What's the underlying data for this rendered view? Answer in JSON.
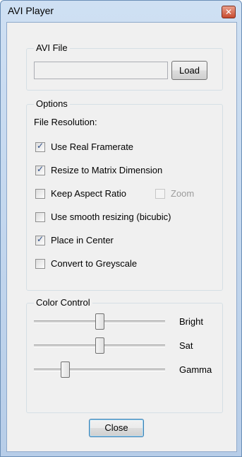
{
  "window": {
    "title": "AVI Player",
    "close_glyph": "✕"
  },
  "avi_file": {
    "legend": "AVI File",
    "path_value": "",
    "load_label": "Load"
  },
  "options": {
    "legend": "Options",
    "file_resolution_label": "File Resolution:",
    "use_real_framerate": {
      "label": "Use Real Framerate",
      "checked": true
    },
    "resize_to_matrix": {
      "label": "Resize to Matrix Dimension",
      "checked": true
    },
    "keep_aspect_ratio": {
      "label": "Keep Aspect Ratio",
      "checked": false
    },
    "zoom": {
      "label": "Zoom",
      "checked": false,
      "enabled": false
    },
    "smooth_resizing": {
      "label": "Use smooth resizing (bicubic)",
      "checked": false
    },
    "place_in_center": {
      "label": "Place in Center",
      "checked": true
    },
    "convert_greyscale": {
      "label": "Convert to Greyscale",
      "checked": false
    }
  },
  "color_control": {
    "legend": "Color Control",
    "bright": {
      "label": "Bright",
      "level": 0.5
    },
    "sat": {
      "label": "Sat",
      "level": 0.5
    },
    "gamma": {
      "label": "Gamma",
      "level": 0.22
    }
  },
  "close_label": "Close",
  "check_glyph": "✓"
}
